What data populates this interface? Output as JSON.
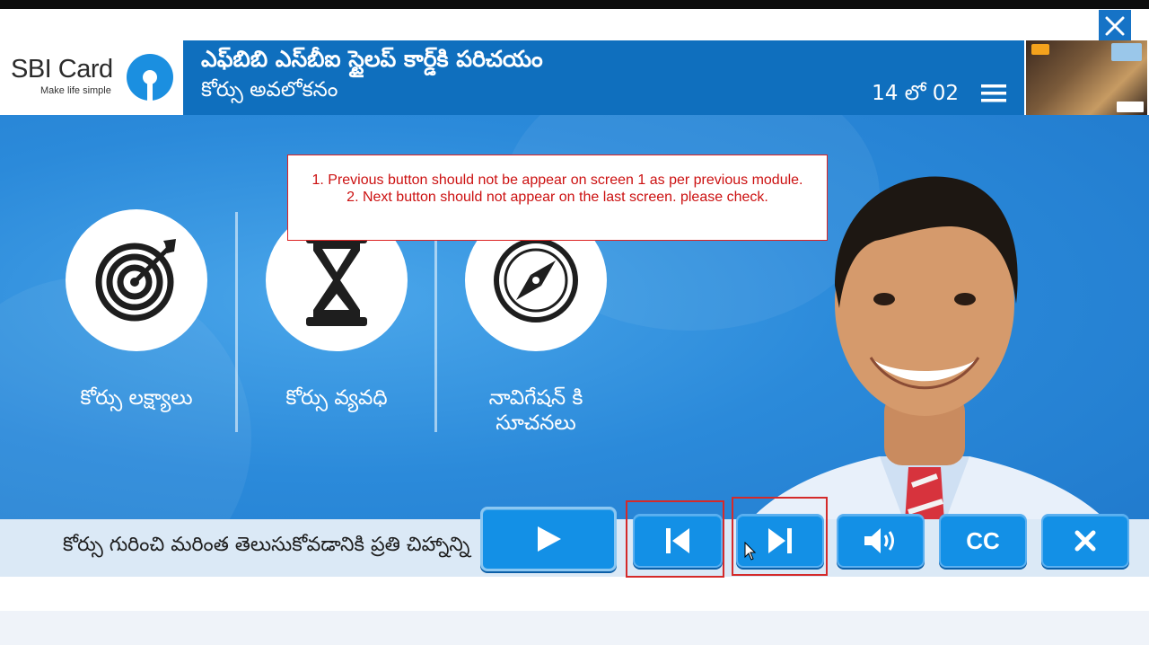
{
  "header": {
    "logo_text": "SBI Card",
    "logo_tagline": "Make life simple",
    "course_title": "ఎఫ్‌బిబి ఎస్‌బీఐ స్టైలప్ కార్డ్‌కి పరిచయం",
    "section_title": "కోర్సు అవలోకనం",
    "page_counter": "14 లో 02"
  },
  "pillars": [
    {
      "label": "కోర్సు లక్ష్యాలు",
      "icon": "target-icon"
    },
    {
      "label": "కోర్సు వ్యవధి",
      "icon": "hourglass-icon"
    },
    {
      "label": "నావిగేషన్ కి సూచనలు",
      "icon": "compass-icon"
    }
  ],
  "review_note": {
    "line1": "1. Previous button should not be appear on screen 1 as per previous module.",
    "line2": "2. Next button should not appear on the last screen. please check."
  },
  "footer": {
    "marquee_text": "కోర్సు గురించి మరింత తెలుసుకోవడానికి ప్రతి చిహ్నాన్ని"
  },
  "controls": [
    {
      "name": "play-button",
      "icon": "play-icon"
    },
    {
      "name": "previous-button",
      "icon": "skip-back-icon"
    },
    {
      "name": "next-button",
      "icon": "skip-forward-icon"
    },
    {
      "name": "audio-button",
      "icon": "speaker-icon"
    },
    {
      "name": "captions-button",
      "label": "CC"
    },
    {
      "name": "exit-button",
      "icon": "close-icon"
    }
  ],
  "colors": {
    "brand_blue": "#0f6fbe",
    "stage_blue": "#2b8ada",
    "control_blue": "#1390e6",
    "review_red": "#d42a2a"
  }
}
